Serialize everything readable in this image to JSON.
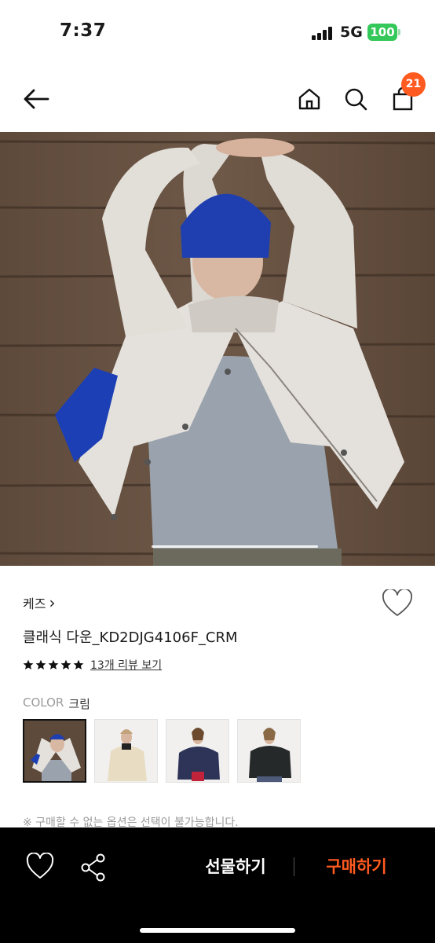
{
  "status_bar": {
    "time": "7:37",
    "network": "5G",
    "battery": "100"
  },
  "nav": {
    "back_icon": "arrow-left-icon",
    "home_icon": "home-icon",
    "search_icon": "search-icon",
    "cart_icon": "shopping-bag-icon",
    "cart_badge": "21"
  },
  "product": {
    "brand": "케즈",
    "brand_chevron": "›",
    "name": "클래식 다운_KD2DJG4106F_CRM",
    "rating": 5,
    "review_link": "13개 리뷰 보기",
    "color_label": "COLOR",
    "color_value": "크림",
    "swatches": [
      "크림 다운",
      "베이지 다운",
      "네이비 다운",
      "블랙 다운"
    ],
    "selected_swatch": 0,
    "notice": "※ 구매할 수 없는 옵션은 선택이 불가능합니다."
  },
  "bottom_bar": {
    "gift_label": "선물하기",
    "buy_label": "구매하기"
  },
  "colors": {
    "accent": "#ff5a1f",
    "battery": "#34c759"
  }
}
